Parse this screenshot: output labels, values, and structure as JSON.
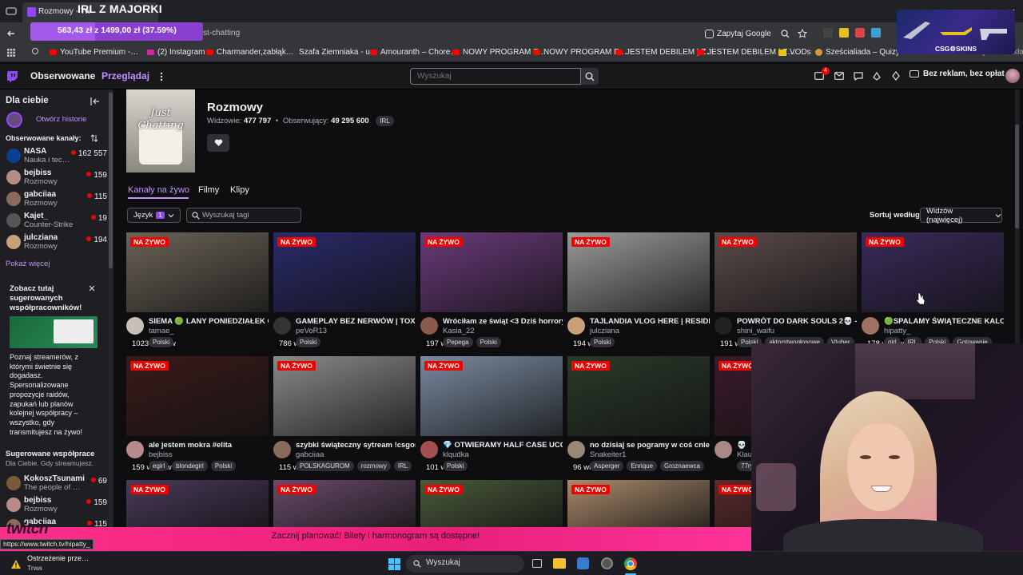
{
  "browser": {
    "tab_title": "Rozmowy - Tw",
    "overlay_title": "IRL Z MAJORKI",
    "progress_text": "563,43 zł z 1499,00 zł (37.59%)",
    "progress_fraction": 0.3759,
    "url": "st-chatting",
    "google_button": "Zapytaj Google",
    "bookmarks": [
      "YouTube Premium -…",
      "(2) Instagram",
      "Charmander,zabłąk…",
      "Szafa Ziemniaka - u…",
      "Amouranth – Chore…",
      "NOWY PROGRAM F…",
      "NOWY PROGRAM F…",
      "JESTEM DEBILEM | Z…",
      "JESTEM DEBILEM | Z…",
      "VODs",
      "Sześcialiada – Quizy…",
      "wszystkie zakładki"
    ],
    "csg_label": "CSG⚙SKINS"
  },
  "nav": {
    "followed": "Obserwowane",
    "browse": "Przeglądaj",
    "search_placeholder": "Wyszukaj",
    "notif_count": "4",
    "no_ads": "Bez reklam, bez opłat"
  },
  "sidebar": {
    "for_you": "Dla ciebie",
    "open_history": "Otwórz historie",
    "followed_header": "Obserwowane kanały:",
    "channels": [
      {
        "name": "NASA",
        "category": "Nauka i tec…",
        "viewers": "162 557",
        "color": "#0b3d91"
      },
      {
        "name": "bejbiss",
        "category": "Rozmowy",
        "viewers": "159",
        "color": "#b98a8a"
      },
      {
        "name": "gabciiaa",
        "category": "Rozmowy",
        "viewers": "115",
        "color": "#8a6a5a"
      },
      {
        "name": "Kajet_",
        "category": "Counter-Strike",
        "viewers": "19",
        "color": "#555"
      },
      {
        "name": "julcziana",
        "category": "Rozmowy",
        "viewers": "194",
        "color": "#c9a07a"
      }
    ],
    "show_more": "Pokaż więcej",
    "promo_title": "Zobacz tutaj sugerowanych współpracowników!",
    "promo_body": "Poznaj streamerów, z którymi świetnie się dogadasz. Spersonalizowane propozycje raidów, zapukań lub planów kolejnej współpracy – wszystko, gdy transmitujesz na żywo!",
    "suggested_header": "Sugerowane współprace",
    "suggested_sub": "Dla Ciebie. Gdy streamujesz.",
    "suggested": [
      {
        "name": "KokoszTsunami",
        "category": "The people of …",
        "viewers": "69",
        "color": "#7a5a3a"
      },
      {
        "name": "bejbiss",
        "category": "Rozmowy",
        "viewers": "159",
        "color": "#b98a8a"
      },
      {
        "name": "gabciiaa",
        "category": "",
        "viewers": "115",
        "color": "#8a6a5a"
      }
    ],
    "status_url": "https://www.twitch.tv/hipatty_"
  },
  "category": {
    "name": "Rozmowy",
    "viewers_label": "Widzowie:",
    "viewers": "477 797",
    "followers_label": "Obserwujący:",
    "followers": "49 295 600",
    "tag": "IRL",
    "art_text": "Just Chatting",
    "tabs": [
      "Kanały na żywo",
      "Filmy",
      "Klipy"
    ],
    "language_label": "Język",
    "language_count": "1",
    "tag_search_placeholder": "Wyszukaj tagi",
    "sort_label": "Sortuj według",
    "sort_value": "Widzów (najwięcej)"
  },
  "live_label": "NA ŻYWO",
  "streams": [
    {
      "viewers": "1023 widzów",
      "title": "SIEMA 🟢 LANY PONIEDZIAŁEK CA…",
      "channel": "tamae_",
      "tags": [
        "Polski"
      ],
      "bg": "#6b6358",
      "av": "#c8c0b8"
    },
    {
      "viewers": "786 widzów",
      "title": "GAMEPLAY BEZ NERWÓW | TOXIC…",
      "channel": "peVoR13",
      "tags": [
        "Polski"
      ],
      "bg": "#2a2a6a",
      "av": "#333"
    },
    {
      "viewers": "197 widzów",
      "title": "Wróciłam ze świąt <3 Dziś horrory …",
      "channel": "Kasia_22",
      "tags": [
        "Pepega",
        "Polski"
      ],
      "bg": "#6a3a7a",
      "av": "#8a5a4a"
    },
    {
      "viewers": "194 widzów",
      "title": "TAJLANDIA VLOG HERE | RESIDEN…",
      "channel": "julcziana",
      "tags": [
        "Polski"
      ],
      "bg": "#9a9a98",
      "av": "#c9a07a"
    },
    {
      "viewers": "191 widzów",
      "title": "POWRÓT DO DARK SOULS 2💀 - p…",
      "channel": "shini_waifu",
      "tags": [
        "Polski",
        "aktorstwogłosowe",
        "Vtuber"
      ],
      "bg": "#5a4a4a",
      "av": "#222"
    },
    {
      "viewers": "178 widzów",
      "title": "🟢SPALAMY ŚWIĄTECZNE KALOR…",
      "channel": "hipatty_",
      "tags": [
        "girl",
        "IRL",
        "Polski",
        "Gotowanie"
      ],
      "bg": "#3a2a5a",
      "av": "#a07060"
    },
    {
      "viewers": "159 widzów",
      "title": "ale jestem mokra #elita",
      "channel": "bejbiss",
      "tags": [
        "egirl",
        "blondegirl",
        "Polski"
      ],
      "bg": "#3a1a1a",
      "av": "#b98a8a"
    },
    {
      "viewers": "115 widzów",
      "title": "szybki świąteczny sytream !csgos…",
      "channel": "gabciiaa",
      "tags": [
        "POLSKAGUROM",
        "rozmowy",
        "IRL"
      ],
      "bg": "#8a8a88",
      "av": "#8a6a5a"
    },
    {
      "viewers": "101 widzów",
      "title": "💎 OTWIERAMY HALF CASE UCC! …",
      "channel": "klqudka",
      "tags": [
        "Polski"
      ],
      "bg": "#7a8aa0",
      "av": "#a05050"
    },
    {
      "viewers": "96 widzów",
      "title": "no dzisiaj se pogramy w coś cnie? …",
      "channel": "Snakeiter1",
      "tags": [
        "Asperger",
        "Enrique",
        "Groznaewca"
      ],
      "bg": "#2a3a2a",
      "av": "#998877"
    },
    {
      "viewers": "",
      "title": "💀 ",
      "channel": "Klau",
      "tags": [
        "77ry"
      ],
      "bg": "#3a1a2a",
      "av": "#aa8888"
    },
    {
      "viewers": "",
      "title": "",
      "channel": "",
      "tags": [],
      "bg": "#4a5a6a",
      "av": "#555"
    },
    {
      "viewers": "",
      "title": "",
      "channel": "",
      "tags": [],
      "bg": "#4a3a5a",
      "av": "#555"
    },
    {
      "viewers": "",
      "title": "",
      "channel": "",
      "tags": [],
      "bg": "#6a4a6a",
      "av": "#555"
    },
    {
      "viewers": "",
      "title": "",
      "channel": "",
      "tags": [],
      "bg": "#4a5a3a",
      "av": "#555"
    },
    {
      "viewers": "",
      "title": "",
      "channel": "",
      "tags": [],
      "bg": "#aa8a6a",
      "av": "#555"
    },
    {
      "viewers": "",
      "title": "",
      "channel": "",
      "tags": [],
      "bg": "#5a2a2a",
      "av": "#555"
    }
  ],
  "banner_text": "Zacznij planować! Bilety i harmonogram są dostępne!",
  "twitch_logo_text": "twitch",
  "taskbar": {
    "search_placeholder": "Wyszukaj",
    "notification_title": "Ostrzeżenie prze…",
    "notification_sub": "Trwa"
  },
  "colors": {
    "accent": "#bf94ff",
    "purple": "#9147ff",
    "live": "#eb0400"
  }
}
